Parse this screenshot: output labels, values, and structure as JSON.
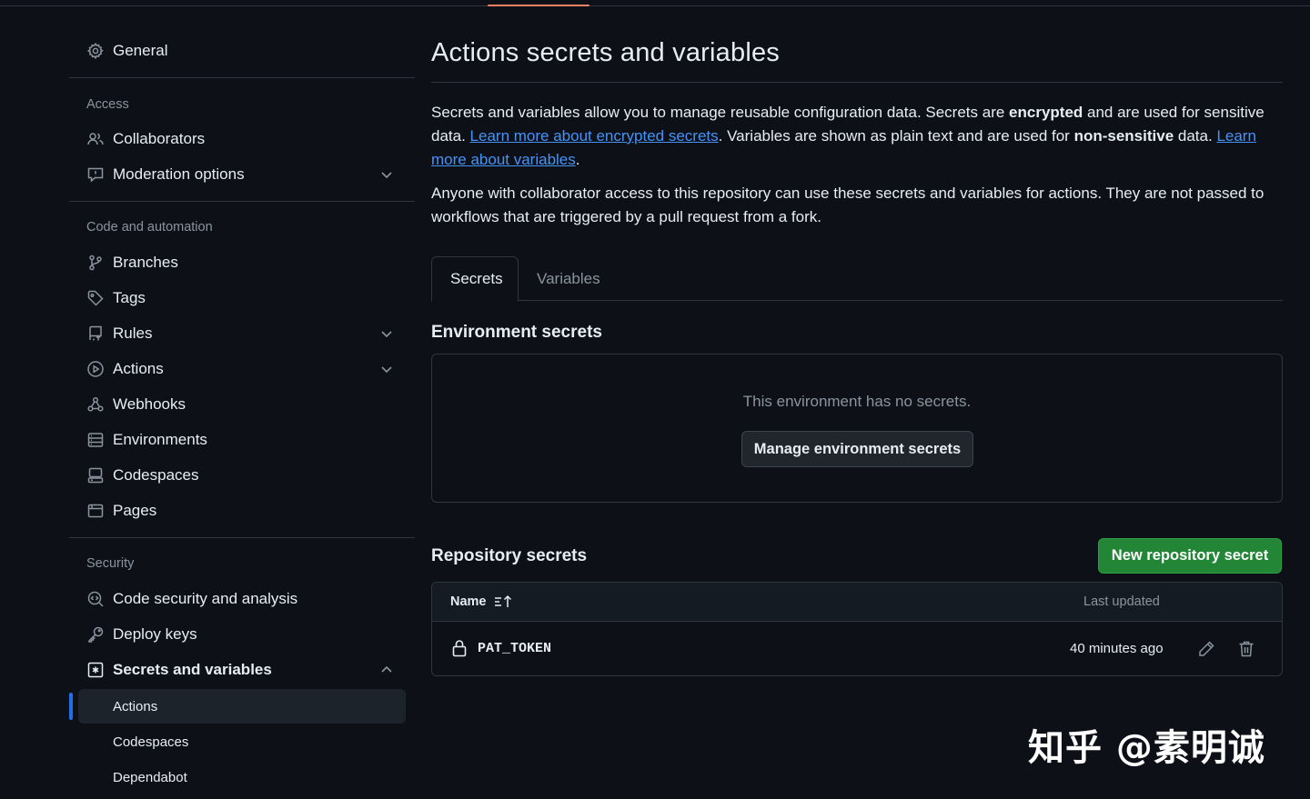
{
  "sidebar": {
    "general": "General",
    "sections": {
      "access": "Access",
      "code_automation": "Code and automation",
      "security": "Security"
    },
    "items": {
      "collaborators": "Collaborators",
      "moderation": "Moderation options",
      "branches": "Branches",
      "tags": "Tags",
      "rules": "Rules",
      "actions": "Actions",
      "webhooks": "Webhooks",
      "environments": "Environments",
      "codespaces": "Codespaces",
      "pages": "Pages",
      "code_security": "Code security and analysis",
      "deploy_keys": "Deploy keys",
      "secrets_variables": "Secrets and variables"
    },
    "sub_items": {
      "actions": "Actions",
      "codespaces": "Codespaces",
      "dependabot": "Dependabot"
    }
  },
  "main": {
    "title": "Actions secrets and variables",
    "intro": {
      "p1_a": "Secrets and variables allow you to manage reusable configuration data. Secrets are ",
      "p1_b": "encrypted",
      "p1_c": " and are used for sensitive data. ",
      "p1_link1": "Learn more about encrypted secrets",
      "p1_d": ". Variables are shown as plain text and are used for ",
      "p1_e": "non-sensitive",
      "p1_f": " data. ",
      "p1_link2": "Learn more about variables",
      "p1_g": ".",
      "p2": "Anyone with collaborator access to this repository can use these secrets and variables for actions. They are not passed to workflows that are triggered by a pull request from a fork."
    },
    "tabs": [
      "Secrets",
      "Variables"
    ],
    "environment": {
      "heading": "Environment secrets",
      "empty_text": "This environment has no secrets.",
      "manage_button": "Manage environment secrets"
    },
    "repository": {
      "heading": "Repository secrets",
      "new_button": "New repository secret",
      "columns": {
        "name": "Name",
        "updated": "Last updated"
      },
      "rows": [
        {
          "name": "PAT_TOKEN",
          "updated": "40 minutes ago"
        }
      ]
    }
  },
  "watermark": "知乎 @素明诚",
  "colors": {
    "background": "#0d1117",
    "border": "#30363d",
    "link": "#4493f8",
    "primary_button": "#238636",
    "active_indicator": "#1f6feb",
    "top_accent": "#f78166"
  }
}
